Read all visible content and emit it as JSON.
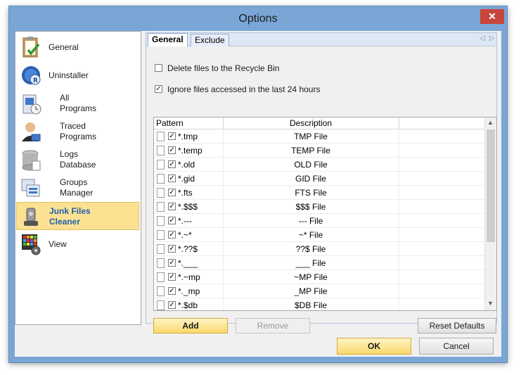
{
  "window": {
    "title": "Options",
    "close_glyph": "✕"
  },
  "nav": {
    "items": [
      {
        "label": "General",
        "icon": "clipboard-check-icon"
      },
      {
        "label": "Uninstaller",
        "icon": "uninstaller-disc-icon"
      },
      {
        "label": "All\nPrograms",
        "icon": "all-programs-icon"
      },
      {
        "label": "Traced\nPrograms",
        "icon": "traced-programs-icon"
      },
      {
        "label": "Logs\nDatabase",
        "icon": "database-icon"
      },
      {
        "label": "Groups\nManager",
        "icon": "groups-icon"
      },
      {
        "label": "Junk Files\nCleaner",
        "icon": "vacuum-icon",
        "selected": true
      },
      {
        "label": "View",
        "icon": "view-grid-icon"
      }
    ]
  },
  "tabs": [
    {
      "label": "General",
      "active": true
    },
    {
      "label": "Exclude",
      "active": false
    }
  ],
  "tabnav": {
    "prev": "◁",
    "next": "▷"
  },
  "options": {
    "recycle": {
      "label": "Delete files to the Recycle Bin",
      "checked": false
    },
    "ignore_recent": {
      "label": "Ignore files accessed in the last 24 hours",
      "checked": true
    }
  },
  "list": {
    "columns": [
      "Pattern",
      "Description"
    ],
    "rows": [
      {
        "pattern": "*.tmp",
        "description": "TMP File"
      },
      {
        "pattern": "*.temp",
        "description": "TEMP File"
      },
      {
        "pattern": "*.old",
        "description": "OLD File"
      },
      {
        "pattern": "*.gid",
        "description": "GID File"
      },
      {
        "pattern": "*.fts",
        "description": "FTS File"
      },
      {
        "pattern": "*.$$$",
        "description": "$$$ File"
      },
      {
        "pattern": "*.---",
        "description": "--- File"
      },
      {
        "pattern": "*.~*",
        "description": "~* File"
      },
      {
        "pattern": "*.??$",
        "description": "??$ File"
      },
      {
        "pattern": "*.___",
        "description": "___ File"
      },
      {
        "pattern": "*.~mp",
        "description": "~MP File"
      },
      {
        "pattern": "*._mp",
        "description": "_MP File"
      },
      {
        "pattern": "*.$db",
        "description": "$DB File"
      }
    ],
    "check_glyph": "✓",
    "scroll_up": "▲",
    "scroll_down": "▼"
  },
  "buttons": {
    "add": "Add",
    "remove": "Remove",
    "reset": "Reset Defaults",
    "ok": "OK",
    "cancel": "Cancel"
  }
}
